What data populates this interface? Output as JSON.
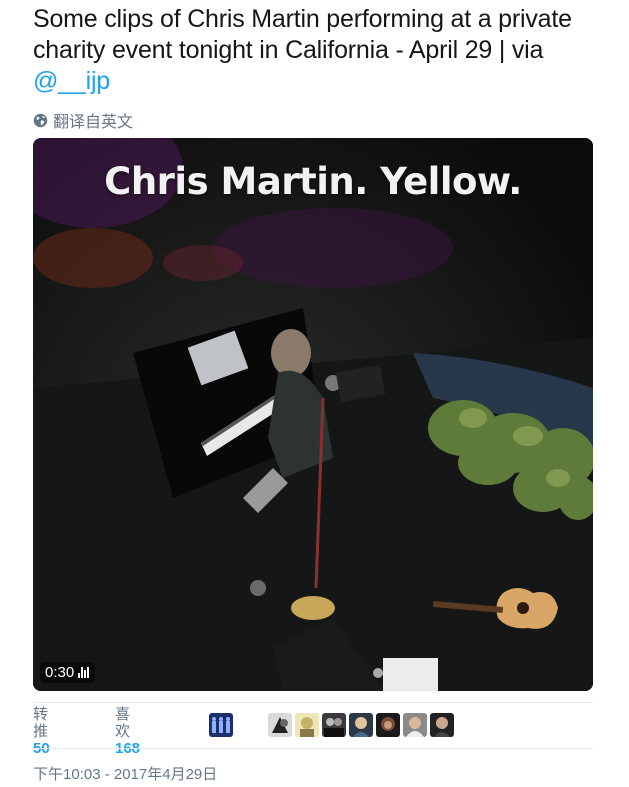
{
  "tweet": {
    "text_prefix": "Some clips of Chris Martin performing at a private charity event tonight in California - April 29 | via ",
    "mention": "@__ijp",
    "translate_label": "翻译自英文"
  },
  "media": {
    "caption": "Chris Martin. Yellow.",
    "duration": "0:30"
  },
  "stats": {
    "retweets_label": "转推",
    "retweets_count": "50",
    "likes_label": "喜欢",
    "likes_count": "168"
  },
  "timestamp": "下午10:03 - 2017年4月29日",
  "colors": {
    "link": "#1da1f2",
    "muted": "#657786",
    "divider": "#e6ecf0"
  },
  "icons": {
    "translate": "globe-icon",
    "duration": "volume-bars-icon"
  }
}
